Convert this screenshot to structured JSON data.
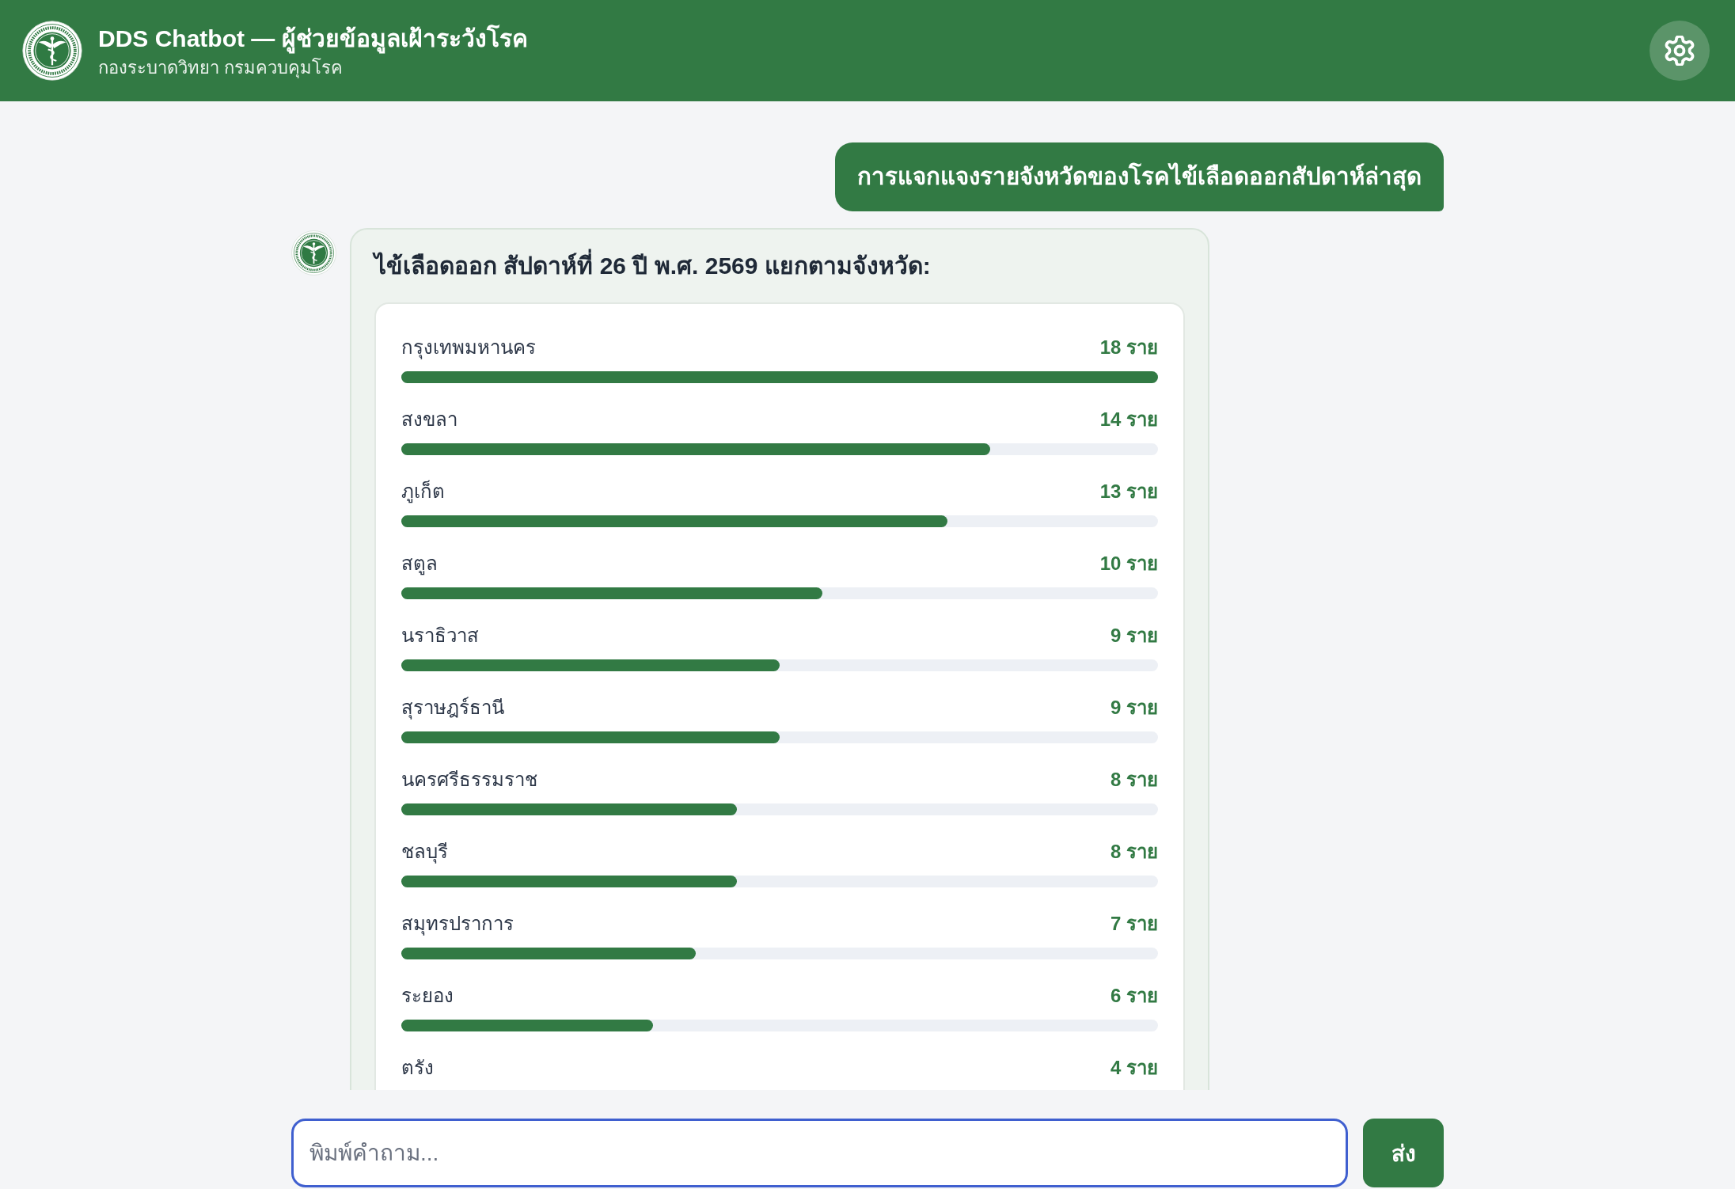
{
  "header": {
    "title": "DDS Chatbot — ผู้ช่วยข้อมูลเฝ้าระวังโรค",
    "subtitle": "กองระบาดวิทยา กรมควบคุมโรค"
  },
  "messages": [
    {
      "kind": "user",
      "text": "การแจกแจงรายจังหวัดของโรคไข้เลือดออกสัปดาห์ล่าสุด"
    },
    {
      "kind": "bot",
      "heading": "ไข้เลือดออก สัปดาห์ที่ 26 ปี พ.ศ. 2569 แยกตามจังหวัด:",
      "rows": [
        {
          "province": "กรุงเทพมหานคร",
          "count": "18 ราย",
          "level": 1
        },
        {
          "province": "สงขลา",
          "count": "14 ราย",
          "level": 0.778
        },
        {
          "province": "ภูเก็ต",
          "count": "13 ราย",
          "level": 0.722
        },
        {
          "province": "สตูล",
          "count": "10 ราย",
          "level": 0.556
        },
        {
          "province": "นราธิวาส",
          "count": "9 ราย",
          "level": 0.5
        },
        {
          "province": "สุราษฎร์ธานี",
          "count": "9 ราย",
          "level": 0.5
        },
        {
          "province": "นครศรีธรรมราช",
          "count": "8 ราย",
          "level": 0.444
        },
        {
          "province": "ชลบุรี",
          "count": "8 ราย",
          "level": 0.444
        },
        {
          "province": "สมุทรปราการ",
          "count": "7 ราย",
          "level": 0.389
        },
        {
          "province": "ระยอง",
          "count": "6 ราย",
          "level": 0.333
        },
        {
          "province": "ตรัง",
          "count": "4 ราย"
        }
      ]
    }
  ],
  "composer": {
    "placeholder": "พิมพ์คำถาม...",
    "send_label": "ส่ง"
  }
}
